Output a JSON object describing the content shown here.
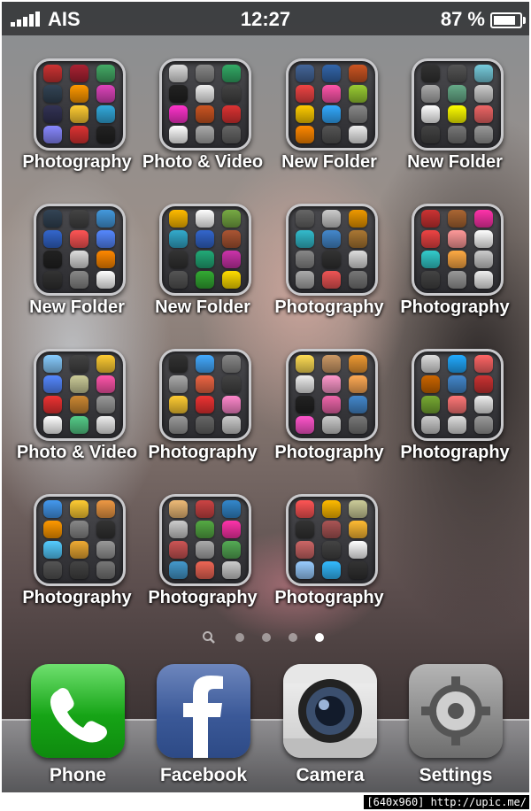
{
  "status_bar": {
    "carrier": "AIS",
    "time": "12:27",
    "battery": "87 %",
    "battery_level": 0.87
  },
  "folders": [
    {
      "label": "Photography",
      "icons": [
        "#c33",
        "#a23",
        "#4a6",
        "#345",
        "#f90",
        "#d4b",
        "#335",
        "#fc3",
        "#3ad",
        "#88f",
        "#d33",
        "#222"
      ]
    },
    {
      "label": "Photo & Video",
      "icons": [
        "#ddd",
        "#888",
        "#3a6",
        "#222",
        "#eee",
        "#444",
        "#f3c",
        "#c52",
        "#d33",
        "#fff",
        "#aaa",
        "#666"
      ]
    },
    {
      "label": "New Folder",
      "icons": [
        "#469",
        "#36a",
        "#c52",
        "#e44",
        "#f5a",
        "#9c3",
        "#fc0",
        "#3af",
        "#888",
        "#f80",
        "#555",
        "#eee"
      ]
    },
    {
      "label": "New Folder",
      "icons": [
        "#333",
        "#555",
        "#7cd",
        "#aaa",
        "#6a8",
        "#ccc",
        "#fff",
        "#ff0",
        "#e66",
        "#444",
        "#777",
        "#999"
      ]
    },
    {
      "label": "New Folder",
      "icons": [
        "#345",
        "#444",
        "#49d",
        "#36c",
        "#f55",
        "#58f",
        "#222",
        "#ddd",
        "#f80",
        "#333",
        "#888",
        "#fff"
      ]
    },
    {
      "label": "New Folder",
      "icons": [
        "#fb0",
        "#fff",
        "#7a4",
        "#3ac",
        "#36c",
        "#a53",
        "#333",
        "#2a7",
        "#c3a",
        "#555",
        "#3a3",
        "#fd0"
      ]
    },
    {
      "label": "Photography",
      "icons": [
        "#666",
        "#ccc",
        "#e90",
        "#3bc",
        "#48c",
        "#a73",
        "#888",
        "#333",
        "#ddd",
        "#aaa",
        "#e55",
        "#777"
      ]
    },
    {
      "label": "Photography",
      "icons": [
        "#c33",
        "#a63",
        "#f3a",
        "#e44",
        "#f99",
        "#fff",
        "#3cc",
        "#fa4",
        "#ccc",
        "#444",
        "#999",
        "#eee"
      ]
    },
    {
      "label": "Photo & Video",
      "icons": [
        "#8cf",
        "#444",
        "#fc3",
        "#58f",
        "#cc9",
        "#f5a",
        "#e33",
        "#c83",
        "#999",
        "#fff",
        "#5c8",
        "#eee"
      ]
    },
    {
      "label": "Photography",
      "icons": [
        "#333",
        "#4af",
        "#888",
        "#aaa",
        "#e64",
        "#444",
        "#fc3",
        "#e33",
        "#f8c",
        "#999",
        "#666",
        "#ccc"
      ]
    },
    {
      "label": "Photography",
      "icons": [
        "#fd5",
        "#c96",
        "#e93",
        "#eee",
        "#f9c",
        "#fa5",
        "#222",
        "#e6a",
        "#48c",
        "#f5c",
        "#ccc",
        "#777"
      ]
    },
    {
      "label": "Photography",
      "icons": [
        "#ddd",
        "#2af",
        "#f66",
        "#c60",
        "#48c",
        "#c33",
        "#7a3",
        "#f77",
        "#eee",
        "#ccc",
        "#ddd",
        "#999"
      ]
    },
    {
      "label": "Photography",
      "icons": [
        "#49e",
        "#fc3",
        "#e94",
        "#f90",
        "#888",
        "#333",
        "#5cf",
        "#ea3",
        "#999",
        "#555",
        "#444",
        "#777"
      ]
    },
    {
      "label": "Photography",
      "icons": [
        "#eb7",
        "#c44",
        "#38c",
        "#ccc",
        "#5a4",
        "#f3a",
        "#c55",
        "#aaa",
        "#5a5",
        "#49c",
        "#e65",
        "#ccc"
      ]
    },
    {
      "label": "Photography",
      "icons": [
        "#f55",
        "#fb0",
        "#cc9",
        "#333",
        "#a55",
        "#fb3",
        "#c66",
        "#444",
        "#fff",
        "#9cf",
        "#3bf",
        "#333"
      ]
    }
  ],
  "page_dots": {
    "count": 4,
    "active_index": 3
  },
  "dock": [
    {
      "label": "Phone",
      "icon": "phone-icon",
      "color": "#2ab32a"
    },
    {
      "label": "Facebook",
      "icon": "facebook-icon",
      "color": "#3b5998"
    },
    {
      "label": "Camera",
      "icon": "camera-icon",
      "color": "#d9d9d9"
    },
    {
      "label": "Settings",
      "icon": "settings-gear-icon",
      "color": "#8a8a8a"
    }
  ],
  "watermark": "[640x960] http://upic.me/"
}
